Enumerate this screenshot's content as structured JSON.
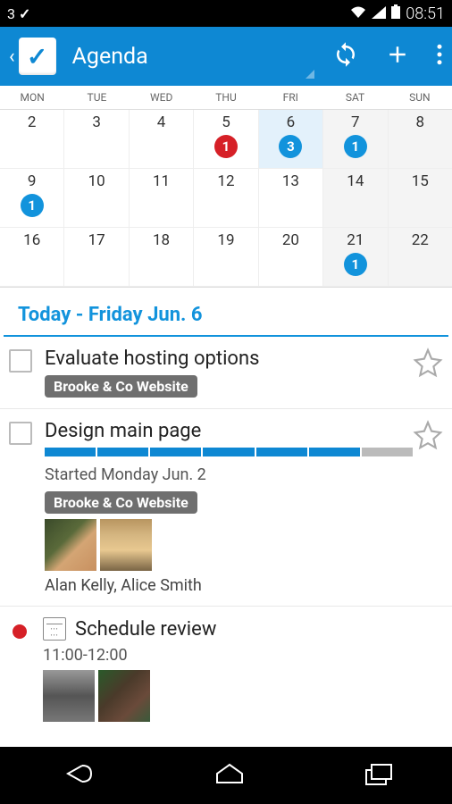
{
  "status": {
    "carrier": "3",
    "time": "08:51"
  },
  "appbar": {
    "title": "Agenda"
  },
  "calendar": {
    "days": [
      "MON",
      "TUE",
      "WED",
      "THU",
      "FRI",
      "SAT",
      "SUN"
    ],
    "rows": [
      [
        {
          "d": "2"
        },
        {
          "d": "3"
        },
        {
          "d": "4"
        },
        {
          "d": "5",
          "badge": "1",
          "badgeColor": "red"
        },
        {
          "d": "6",
          "badge": "3",
          "badgeColor": "blue",
          "today": true
        },
        {
          "d": "7",
          "badge": "1",
          "badgeColor": "blue",
          "weekend": true
        },
        {
          "d": "8",
          "weekend": true
        }
      ],
      [
        {
          "d": "9",
          "badge": "1",
          "badgeColor": "blue"
        },
        {
          "d": "10"
        },
        {
          "d": "11"
        },
        {
          "d": "12"
        },
        {
          "d": "13"
        },
        {
          "d": "14",
          "weekend": true
        },
        {
          "d": "15",
          "weekend": true
        }
      ],
      [
        {
          "d": "16"
        },
        {
          "d": "17"
        },
        {
          "d": "18"
        },
        {
          "d": "19"
        },
        {
          "d": "20"
        },
        {
          "d": "21",
          "badge": "1",
          "badgeColor": "blue",
          "weekend": true
        },
        {
          "d": "22",
          "weekend": true
        }
      ]
    ]
  },
  "today_header": "Today - Friday Jun. 6",
  "tasks": [
    {
      "type": "todo",
      "title": "Evaluate hosting options",
      "tag": "Brooke & Co Website",
      "starred": false
    },
    {
      "type": "todo",
      "title": "Design main page",
      "tag": "Brooke & Co Website",
      "progress": {
        "filled": 6,
        "total": 7
      },
      "started": "Started Monday Jun. 2",
      "people": "Alan Kelly, Alice Smith",
      "starred": false
    },
    {
      "type": "event",
      "title": "Schedule review",
      "time": "11:00-12:00"
    }
  ]
}
